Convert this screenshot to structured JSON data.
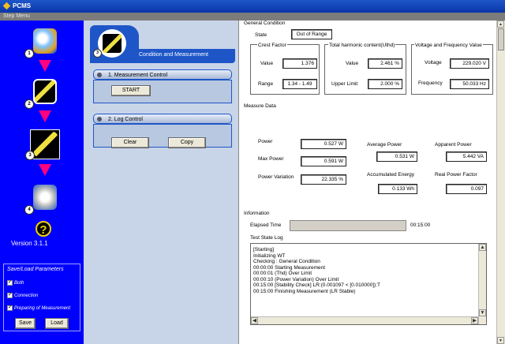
{
  "app": {
    "title": "PCMS",
    "step_menu": "Step Menu",
    "version": "Version 3.1.1"
  },
  "steps": [
    {
      "num": "1"
    },
    {
      "num": "2"
    },
    {
      "num": "3"
    },
    {
      "num": "4"
    }
  ],
  "save_load": {
    "title": "Save/Load Parameters",
    "options": [
      "Both",
      "Connection",
      "Preparing of Measurement"
    ],
    "save_label": "Save",
    "load_label": "Load"
  },
  "middle": {
    "tab_number": "3",
    "tab_title": "Condition and Measurement",
    "measurement_control": {
      "title": "1. Measurement Control",
      "start_label": "START"
    },
    "log_control": {
      "title": "2. Log Control",
      "clear_label": "Clear",
      "copy_label": "Copy"
    }
  },
  "general": {
    "title": "General Condition",
    "state_label": "State",
    "state_value": "Out of Range",
    "crest": {
      "title": "Crest Factor",
      "value_label": "Value",
      "value": "1.376",
      "range_label": "Range",
      "range": "1.34 - 1.49"
    },
    "thd": {
      "title": "Total harmonic content(Uthd)",
      "value_label": "Value",
      "value": "2.461 %",
      "limit_label": "Upper Limit",
      "limit": "2.000 %"
    },
    "vf": {
      "title": "Voltage and Frequency Value",
      "voltage_label": "Voltage",
      "voltage": "229.020 V",
      "frequency_label": "Frequency",
      "frequency": "50.033 Hz"
    }
  },
  "measure": {
    "title": "Measure Data",
    "power_label": "Power",
    "power": "0.527 W",
    "max_power_label": "Max Power",
    "max_power": "0.591 W",
    "power_var_label": "Power Variation",
    "power_var": "22.335 %",
    "avg_power_label": "Average Power",
    "avg_power": "0.531 W",
    "acc_energy_label": "Accumulated Energy",
    "acc_energy": "0.133 Wh",
    "apparent_label": "Apparent Power",
    "apparent": "5.442 VA",
    "rpf_label": "Real Power Factor",
    "rpf": "0.097"
  },
  "info": {
    "title": "Information",
    "elapsed_label": "Elapsed Time",
    "elapsed_value": "00:15:00",
    "elapsed_progress": 1.0,
    "log_title": "Test State Log",
    "log_lines": [
      "[Starting]",
      "Initializing WT",
      "Checking : General Condition",
      "00:00:00 Starting Measurement",
      "00:00:01 (Thd) Over Limit",
      "00:00:10 (Power Variation) Over Limit",
      "00:15:00 [Stability Check] LR:(0.001097 < [0.010000]):T",
      "00:15:00 Finishing Measurement (LR Stable)"
    ]
  },
  "colors": {
    "left_panel": "#0000ff",
    "accent": "#1e56c8",
    "arrow": "#ff0080"
  }
}
